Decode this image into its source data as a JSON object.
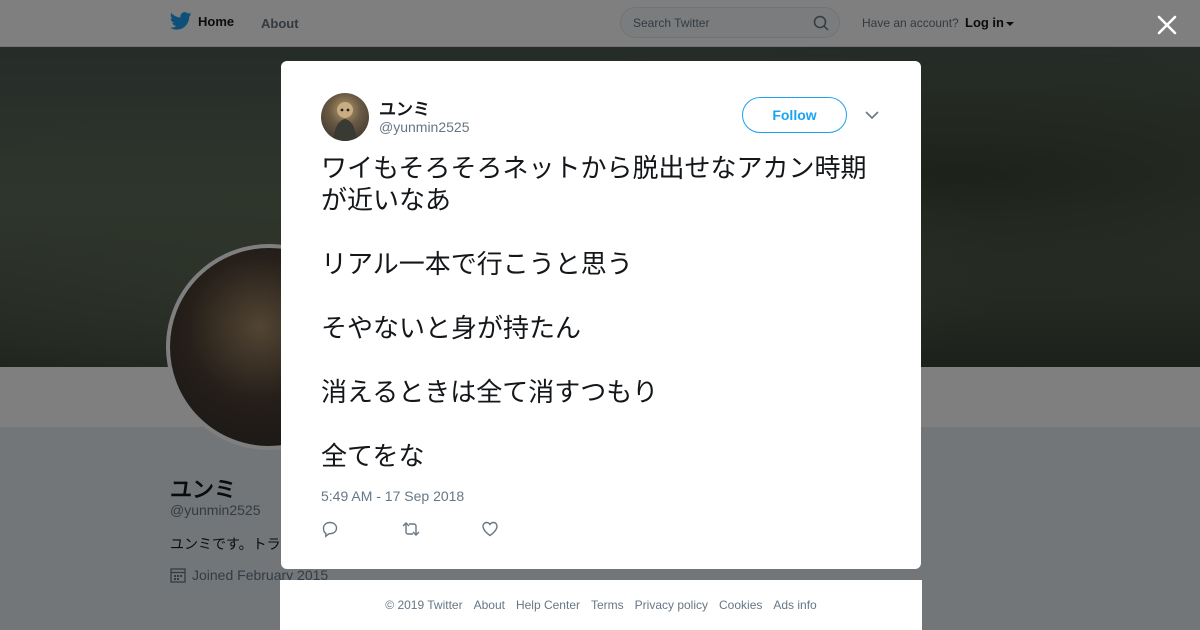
{
  "topbar": {
    "home_label": "Home",
    "about_label": "About",
    "search_placeholder": "Search Twitter",
    "have_account": "Have an account?",
    "login_label": "Log in"
  },
  "profile": {
    "name": "ユンミ",
    "handle": "@yunmin2525",
    "bio": "ユンミです。トラ",
    "joined": "Joined February 2015"
  },
  "tweet": {
    "author_name": "ユンミ",
    "author_handle": "@yunmin2525",
    "follow_label": "Follow",
    "paragraphs": [
      "ワイもそろそろネットから脱出せなアカン時期が近いなあ",
      "リアル一本で行こうと思う",
      "そやないと身が持たん",
      "消えるときは全て消すつもり",
      "全てをな"
    ],
    "timestamp": "5:49 AM - 17 Sep 2018"
  },
  "footer": {
    "links": [
      "© 2019 Twitter",
      "About",
      "Help Center",
      "Terms",
      "Privacy policy",
      "Cookies",
      "Ads info"
    ]
  },
  "colors": {
    "twitter_blue": "#1da1f2",
    "text_primary": "#14171a",
    "text_secondary": "#657786"
  }
}
